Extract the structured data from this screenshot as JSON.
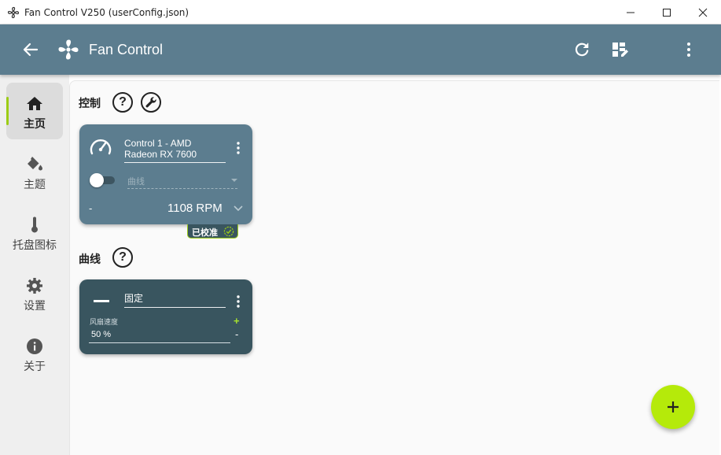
{
  "window": {
    "title": "Fan Control V250 (userConfig.json)",
    "app_icon": "fan-icon",
    "controls": [
      "minimize-icon",
      "maximize-icon",
      "close-icon"
    ]
  },
  "appbar": {
    "title": "Fan Control",
    "icons": [
      "back-arrow-icon",
      "fan-logo-icon",
      "refresh-icon",
      "dashboard-edit-icon",
      "more-vert-icon"
    ],
    "background": "#5c7d8f"
  },
  "sidebar": {
    "items": [
      {
        "label": "主页",
        "icon": "home-icon",
        "active": true
      },
      {
        "label": "主题",
        "icon": "paint-bucket-icon",
        "active": false
      },
      {
        "label": "托盘图标",
        "icon": "thermometer-icon",
        "active": false
      },
      {
        "label": "设置",
        "icon": "gear-icon",
        "active": false
      },
      {
        "label": "关于",
        "icon": "info-icon",
        "active": false
      }
    ],
    "accent": "#9ccc16"
  },
  "controls_section": {
    "title": "控制",
    "help_glyph": "?",
    "icons": [
      "help-icon",
      "wrench-icon"
    ]
  },
  "control_card": {
    "name": "Control 1 - AMD Radeon RX 7600",
    "curve_select": "曲线",
    "enabled": false,
    "left_value": "-",
    "rpm": "1108 RPM",
    "badge": "已校准",
    "color": "#5c7d8f"
  },
  "curves_section": {
    "title": "曲线",
    "help_glyph": "?"
  },
  "curve_card": {
    "name": "固定",
    "field_label": "风扇速度",
    "field_value": "50 %",
    "plus": "+",
    "minus": "-",
    "color": "#39555f"
  },
  "fab": {
    "icon": "plus-icon",
    "color": "#b5ea0a"
  }
}
